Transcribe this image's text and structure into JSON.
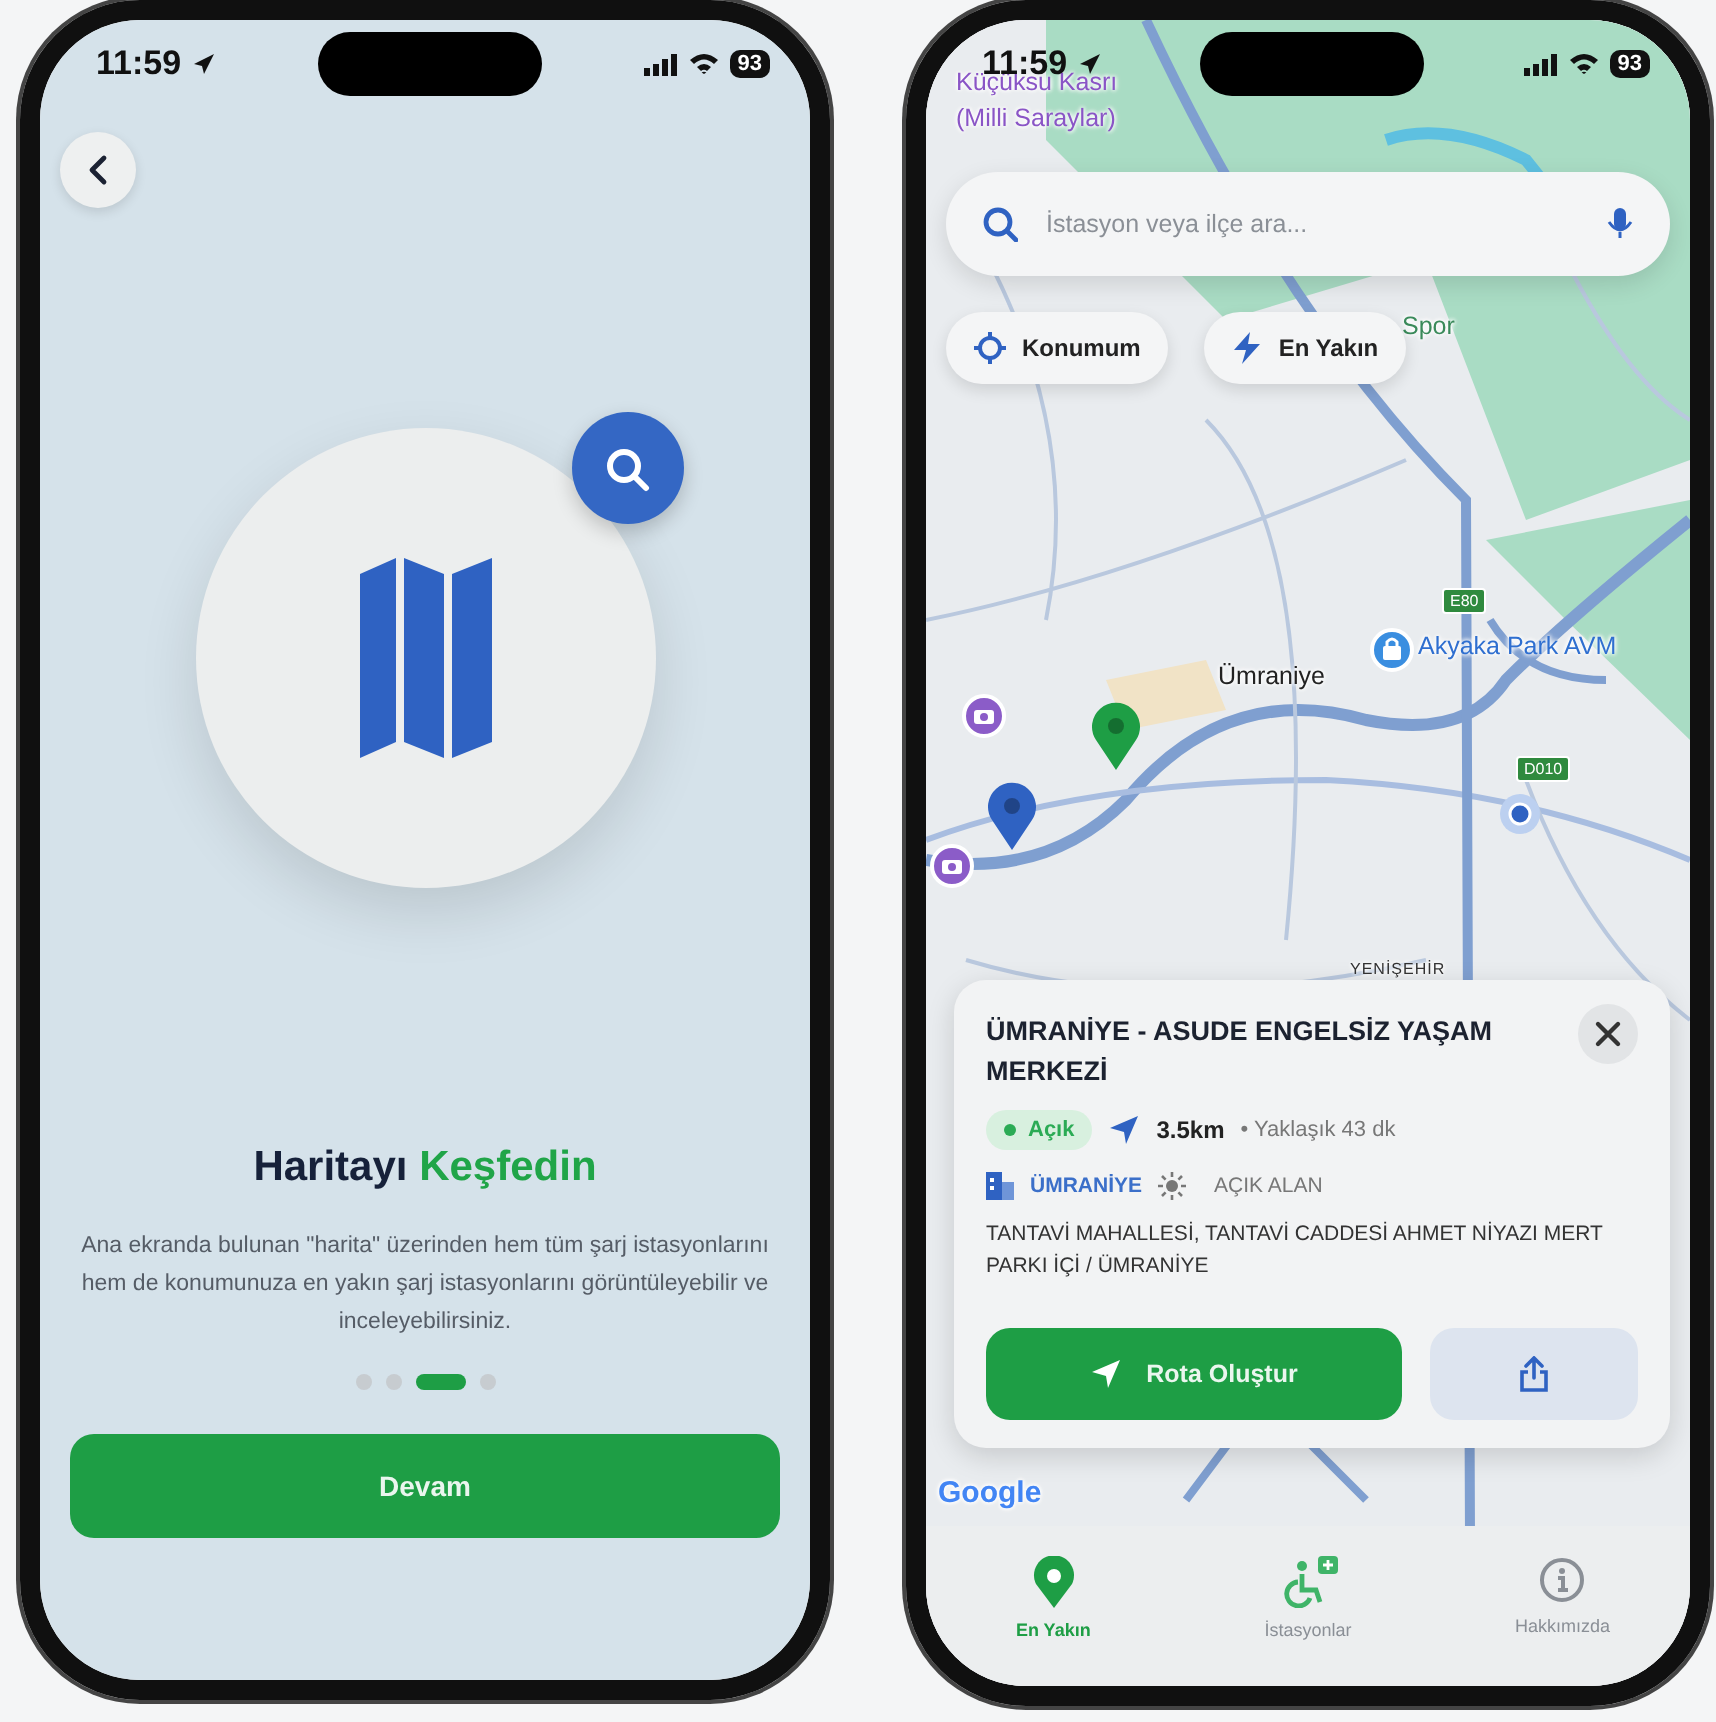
{
  "onboarding_screen": {
    "status_bar": {
      "time": "11:59",
      "battery": "93"
    },
    "title_parts": [
      {
        "text": "Haritayı",
        "kind": "plain"
      },
      {
        "text": "Keşfedin",
        "kind": "accent"
      }
    ],
    "description": "Ana ekranda bulunan \"harita\" üzerinden hem tüm şarj istasyonlarını hem de konumunuza en yakın şarj istasyonlarını görüntüleyebilir ve inceleyebilirsiniz.",
    "pager": [
      {
        "selected": false
      },
      {
        "selected": false
      },
      {
        "selected": true
      },
      {
        "selected": false
      }
    ],
    "continue_button": "Devam"
  },
  "map_screen": {
    "status_bar": {
      "time": "11:59",
      "battery": "93"
    },
    "map_labels": [
      {
        "text": "Küçüksu Kasrı",
        "kind": "poi"
      },
      {
        "text": "(Milli Saraylar)",
        "kind": "poi"
      },
      {
        "text": "Spor",
        "kind": "park"
      },
      {
        "text": "E80",
        "kind": "shield"
      },
      {
        "text": "Akyaka Park AVM",
        "kind": "shop"
      },
      {
        "text": "Ümraniye",
        "kind": "place"
      },
      {
        "text": "D010",
        "kind": "shield"
      },
      {
        "text": "YENİŞEHİR",
        "kind": "district"
      },
      {
        "text": "Google",
        "kind": "brand"
      }
    ],
    "markers": [
      {
        "color": "#1e9e45"
      },
      {
        "color": "#2f62c2"
      }
    ],
    "search": {
      "placeholder": "İstasyon veya ilçe ara..."
    },
    "chips": [
      {
        "label": "Konumum",
        "kind": "location"
      },
      {
        "label": "En Yakın",
        "kind": "bolt"
      }
    ],
    "station_card": {
      "title": "ÜMRANİYE - ASUDE ENGELSİZ YAŞAM MERKEZİ",
      "status": "Açık",
      "open": true,
      "distance": "3.5km",
      "eta": "• Yaklaşık 43 dk",
      "district": "ÜMRANİYE",
      "area_type": "AÇIK ALAN",
      "address": "TANTAVİ MAHALLESİ, TANTAVİ CADDESİ AHMET NİYAZI MERT PARKI İÇİ / ÜMRANİYE",
      "route_button": "Rota Oluştur"
    },
    "tab_bar": [
      {
        "label": "En Yakın",
        "kind": "pin",
        "selected": true
      },
      {
        "label": "İstasyonlar",
        "kind": "wheelchair",
        "selected": false
      },
      {
        "label": "Hakkımızda",
        "kind": "info",
        "selected": false
      }
    ]
  }
}
